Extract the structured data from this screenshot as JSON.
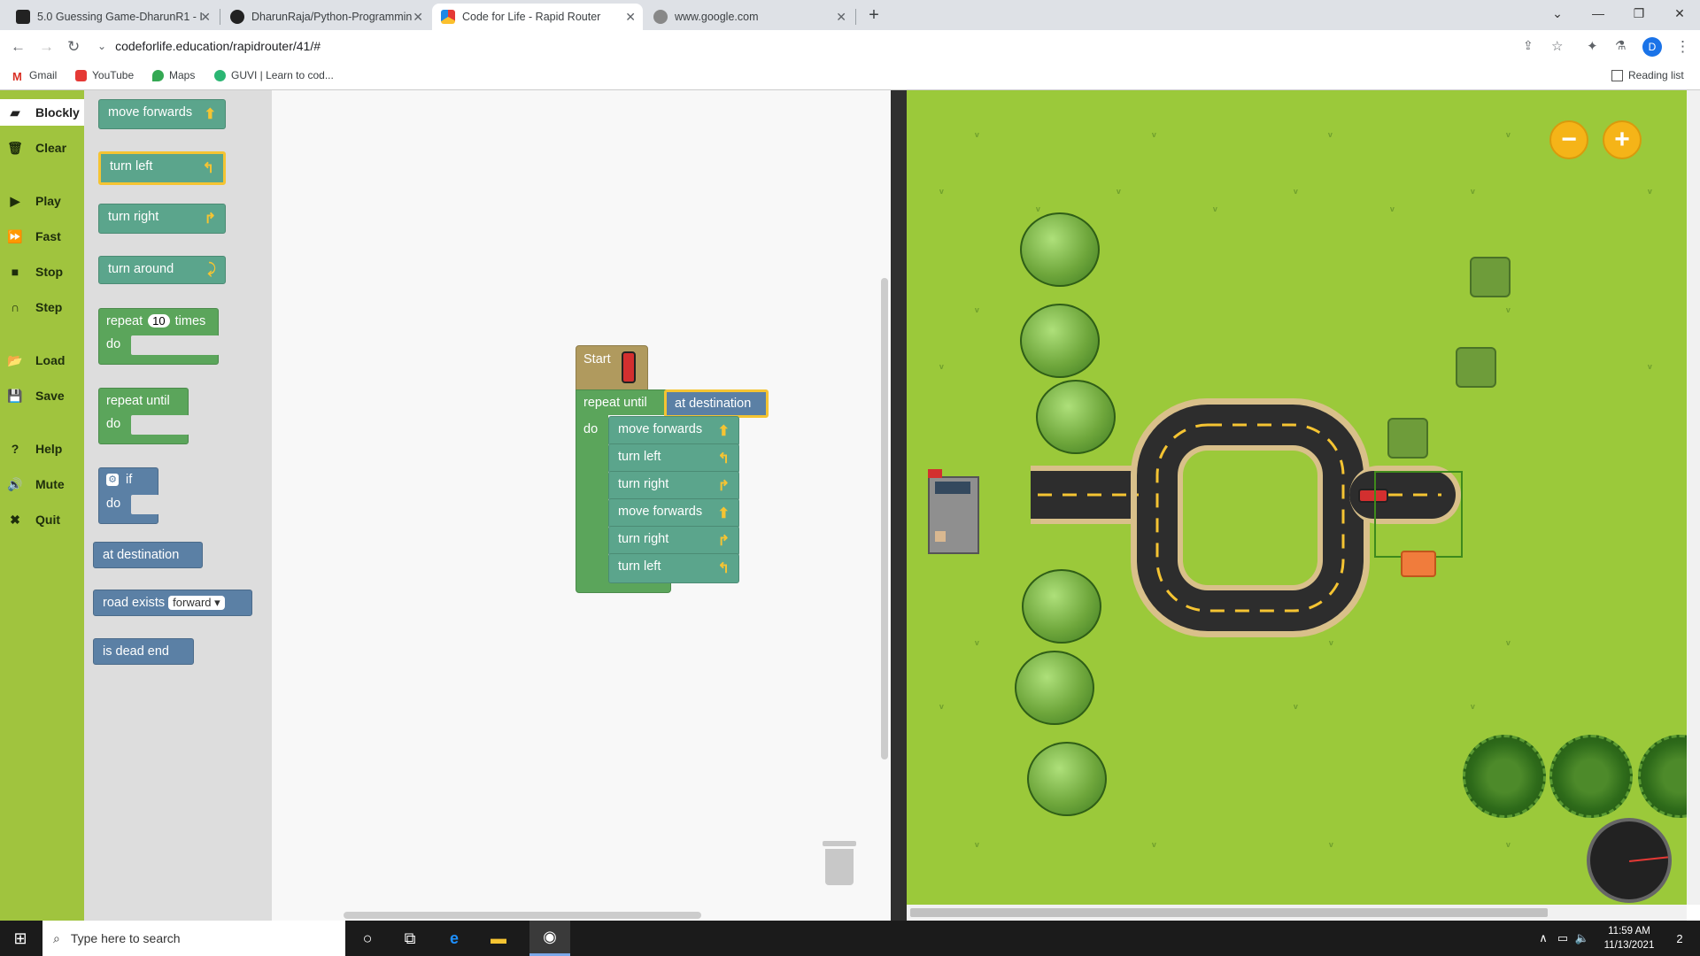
{
  "browser": {
    "tabs": [
      {
        "title": "5.0 Guessing Game-DharunR1 - I"
      },
      {
        "title": "DharunRaja/Python-Programmin"
      },
      {
        "title": "Code for Life - Rapid Router"
      },
      {
        "title": "www.google.com"
      }
    ],
    "new_tab": "+",
    "url": "codeforlife.education/rapidrouter/41/#",
    "bookmarks": [
      "Gmail",
      "YouTube",
      "Maps",
      "GUVI | Learn to cod..."
    ],
    "reading_list": "Reading list",
    "profile_initial": "D"
  },
  "sidebar": {
    "items": [
      {
        "label": "Blockly",
        "icon": "blockly-icon"
      },
      {
        "label": "Clear",
        "icon": "trash-icon"
      },
      {
        "label": "Play",
        "icon": "play-icon"
      },
      {
        "label": "Fast",
        "icon": "fast-icon"
      },
      {
        "label": "Stop",
        "icon": "stop-icon"
      },
      {
        "label": "Step",
        "icon": "step-icon"
      },
      {
        "label": "Load",
        "icon": "folder-icon"
      },
      {
        "label": "Save",
        "icon": "save-icon"
      },
      {
        "label": "Help",
        "icon": "help-icon"
      },
      {
        "label": "Mute",
        "icon": "speaker-icon"
      },
      {
        "label": "Quit",
        "icon": "close-icon"
      }
    ]
  },
  "toolbox": {
    "move_forwards": "move forwards",
    "turn_left": "turn left",
    "turn_right": "turn right",
    "turn_around": "turn around",
    "repeat": "repeat",
    "repeat_count": "10",
    "times": "times",
    "do": "do",
    "repeat_until": "repeat until",
    "if": "if",
    "at_destination": "at destination",
    "road_exists": "road exists",
    "road_dir": "forward",
    "dead_end": "is dead end"
  },
  "program": {
    "start": "Start",
    "repeat_until": "repeat until",
    "condition": "at destination",
    "do": "do",
    "steps": [
      "move forwards",
      "turn left",
      "turn right",
      "move forwards",
      "turn right",
      "turn left"
    ]
  },
  "taskbar": {
    "search_placeholder": "Type here to search",
    "time": "11:59 AM",
    "date": "11/13/2021",
    "notifications": "2"
  },
  "colors": {
    "accent_green": "#a0c43e",
    "block_green": "#5ba58c",
    "block_blue": "#5b80a5",
    "map_grass": "#9bc93a",
    "zoom_button": "#f5b418"
  }
}
